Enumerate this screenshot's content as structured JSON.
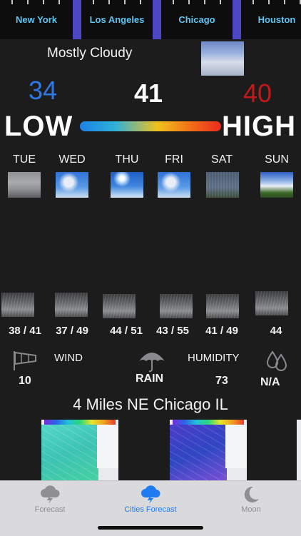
{
  "city_tabs": [
    "New York",
    "Los Angeles",
    "Chicago",
    "Houston"
  ],
  "current": {
    "condition": "Mostly Cloudy",
    "low": "34",
    "temp": "41",
    "high": "40",
    "low_label": "LOW",
    "high_label": "HIGH"
  },
  "forecast": [
    {
      "day": "TUE",
      "range": "38 / 41",
      "icon": "overcast-icon"
    },
    {
      "day": "WED",
      "range": "37 / 49",
      "icon": "partly-cloudy-icon"
    },
    {
      "day": "THU",
      "range": "44 / 51",
      "icon": "sunny-icon"
    },
    {
      "day": "FRI",
      "range": "43 / 55",
      "icon": "partly-cloudy-icon"
    },
    {
      "day": "SAT",
      "range": "41 / 49",
      "icon": "storm-icon"
    },
    {
      "day": "SUN",
      "range": "44",
      "icon": "clear-field-icon"
    }
  ],
  "metrics": {
    "wind_label": "WIND",
    "wind_value": "10",
    "rain_label": "RAIN",
    "humidity_label": "HUMIDITY",
    "humidity_value": "73",
    "precip_value": "N/A"
  },
  "location": "4 Miles NE Chicago IL",
  "tabbar": {
    "items": [
      {
        "label": "Forecast",
        "icon": "cloud-lightning-icon",
        "active": false
      },
      {
        "label": "Cities Forecast",
        "icon": "cloud-lightning-icon",
        "active": true
      },
      {
        "label": "Moon",
        "icon": "moon-icon",
        "active": false
      }
    ]
  },
  "colors": {
    "accent_blue": "#1e7cf0",
    "low_blue": "#2f78e8",
    "high_red": "#c2191a",
    "city_text": "#5fc6f2",
    "tab_separator": "#4c47c5",
    "inactive_tab": "#8e8e93"
  }
}
